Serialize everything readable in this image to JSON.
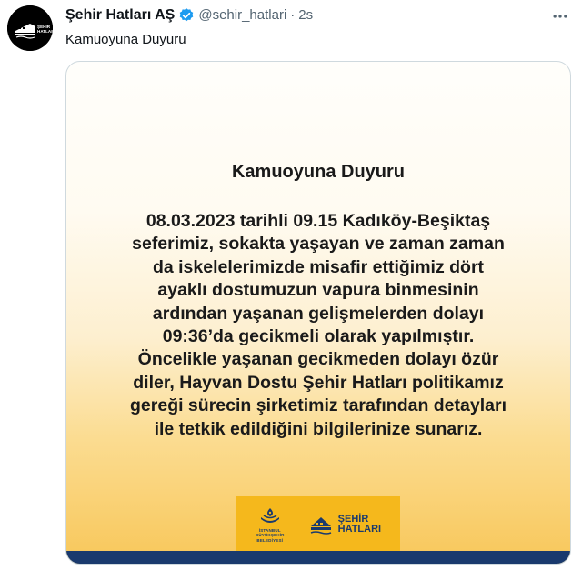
{
  "tweet": {
    "display_name": "Şehir Hatları AŞ",
    "handle": "@sehir_hatlari",
    "separator": "·",
    "time": "2s",
    "text": "Kamuoyuna Duyuru",
    "avatar_text": "ŞEHİR HATLARI",
    "verified_icon": "verified-badge-icon",
    "more_icon": "more-options-icon"
  },
  "media": {
    "title": "Kamuoyuna Duyuru",
    "paragraph1_lines": [
      "08.03.2023 tarihli 09.15 Kadıköy-Beşiktaş",
      "seferimiz, sokakta yaşayan ve zaman zaman",
      "da iskelelerimizde misafir ettiğimiz dört",
      "ayaklı dostumuzun vapura binmesinin",
      "ardından yaşanan gelişmelerden dolayı",
      "09:36’da gecikmeli olarak yapılmıştır."
    ],
    "paragraph2_lines": [
      "Öncelikle yaşanan gecikmeden dolayı özür",
      "diler, Hayvan Dostu Şehir Hatları politikamız",
      "gereği sürecin şirketimiz tarafından detayları",
      "ile tetkik edildiğini bilgilerinize sunarız."
    ],
    "ibb_logo_text": [
      "İSTANBUL",
      "BÜYÜKŞEHİR",
      "BELEDİYESİ"
    ],
    "sh_logo_text": [
      "ŞEHİR",
      "HATLARI"
    ],
    "colors": {
      "gold": "#f5b81c",
      "navy": "#1a3a6e",
      "verified_blue": "#1d9bf0"
    }
  }
}
